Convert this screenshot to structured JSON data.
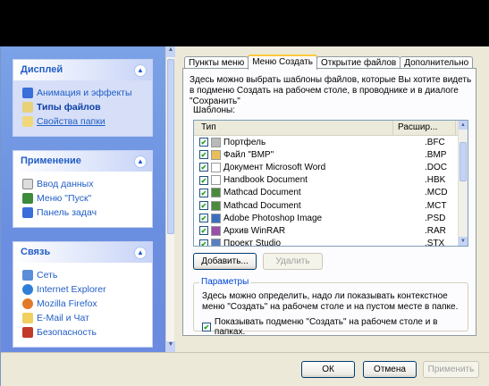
{
  "left_panels": [
    {
      "title": "Дисплей",
      "items": [
        {
          "label": "Анимация и эффекты",
          "icon": "monitor-icon"
        },
        {
          "label": "Типы файлов",
          "icon": "file-types-icon",
          "bold": true
        },
        {
          "label": "Свойства папки",
          "icon": "folder-icon",
          "underline": true
        }
      ]
    },
    {
      "title": "Применение",
      "items": [
        {
          "label": "Ввод данных",
          "icon": "mouse-icon"
        },
        {
          "label": "Меню \"Пуск\"",
          "icon": "start-menu-icon"
        },
        {
          "label": "Панель задач",
          "icon": "taskbar-icon"
        }
      ]
    },
    {
      "title": "Связь",
      "items": [
        {
          "label": "Сеть",
          "icon": "network-icon"
        },
        {
          "label": "Internet Explorer",
          "icon": "ie-icon"
        },
        {
          "label": "Mozilla Firefox",
          "icon": "firefox-icon"
        },
        {
          "label": "E-Mail и Чат",
          "icon": "mail-icon"
        },
        {
          "label": "Безопасность",
          "icon": "security-icon"
        }
      ]
    }
  ],
  "tabs": [
    "Пункты меню",
    "Меню Создать",
    "Открытие файлов",
    "Дополнительно"
  ],
  "active_tab": 1,
  "description": "Здесь можно выбрать шаблоны файлов, которые Вы хотите видеть в подменю Создать на рабочем столе, в проводнике и в диалоге \"Сохранить\"",
  "templates_label": "Шаблоны:",
  "columns": {
    "type": "Тип",
    "ext": "Расшир..."
  },
  "rows": [
    {
      "name": "Портфель",
      "ext": ".BFC",
      "checked": true,
      "color": "#b9b9b9"
    },
    {
      "name": "Файл \"BMP\"",
      "ext": ".BMP",
      "checked": true,
      "color": "#e8c05a"
    },
    {
      "name": "Документ Microsoft Word",
      "ext": ".DOC",
      "checked": true,
      "color": "#ffffff"
    },
    {
      "name": "Handbook Document",
      "ext": ".HBK",
      "checked": true,
      "color": "#ffffff"
    },
    {
      "name": "Mathcad Document",
      "ext": ".MCD",
      "checked": true,
      "color": "#4a8a3c"
    },
    {
      "name": "Mathcad Document",
      "ext": ".MCT",
      "checked": true,
      "color": "#4a8a3c"
    },
    {
      "name": "Adobe Photoshop Image",
      "ext": ".PSD",
      "checked": true,
      "color": "#3a6fc0"
    },
    {
      "name": "Архив WinRAR",
      "ext": ".RAR",
      "checked": true,
      "color": "#9a4fa8"
    },
    {
      "name": "Проект Studio",
      "ext": ".STX",
      "checked": true,
      "color": "#5a7fc0"
    }
  ],
  "buttons": {
    "add": "Добавить...",
    "remove": "Удалить",
    "ok": "ОК",
    "cancel": "Отмена",
    "apply": "Применить"
  },
  "params": {
    "title": "Параметры",
    "desc": "Здесь можно определить, надо ли показывать контекстное меню \"Создать\" на рабочем столе и на пустом месте в папке.",
    "checkbox_label": "Показывать подменю \"Создать\" на рабочем столе и в папках.",
    "checked": true
  }
}
